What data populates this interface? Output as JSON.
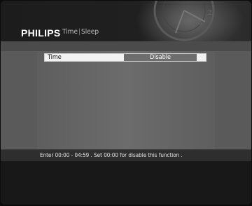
{
  "header": {
    "brand": "PHILIPS",
    "section": "Time",
    "separator": "|",
    "subsection": "Sleep"
  },
  "settings": {
    "time_label": "Time",
    "time_value": "Disable"
  },
  "help": {
    "text": "Enter 00:00 - 04:59 . Set 00:00 for disable this function ."
  }
}
